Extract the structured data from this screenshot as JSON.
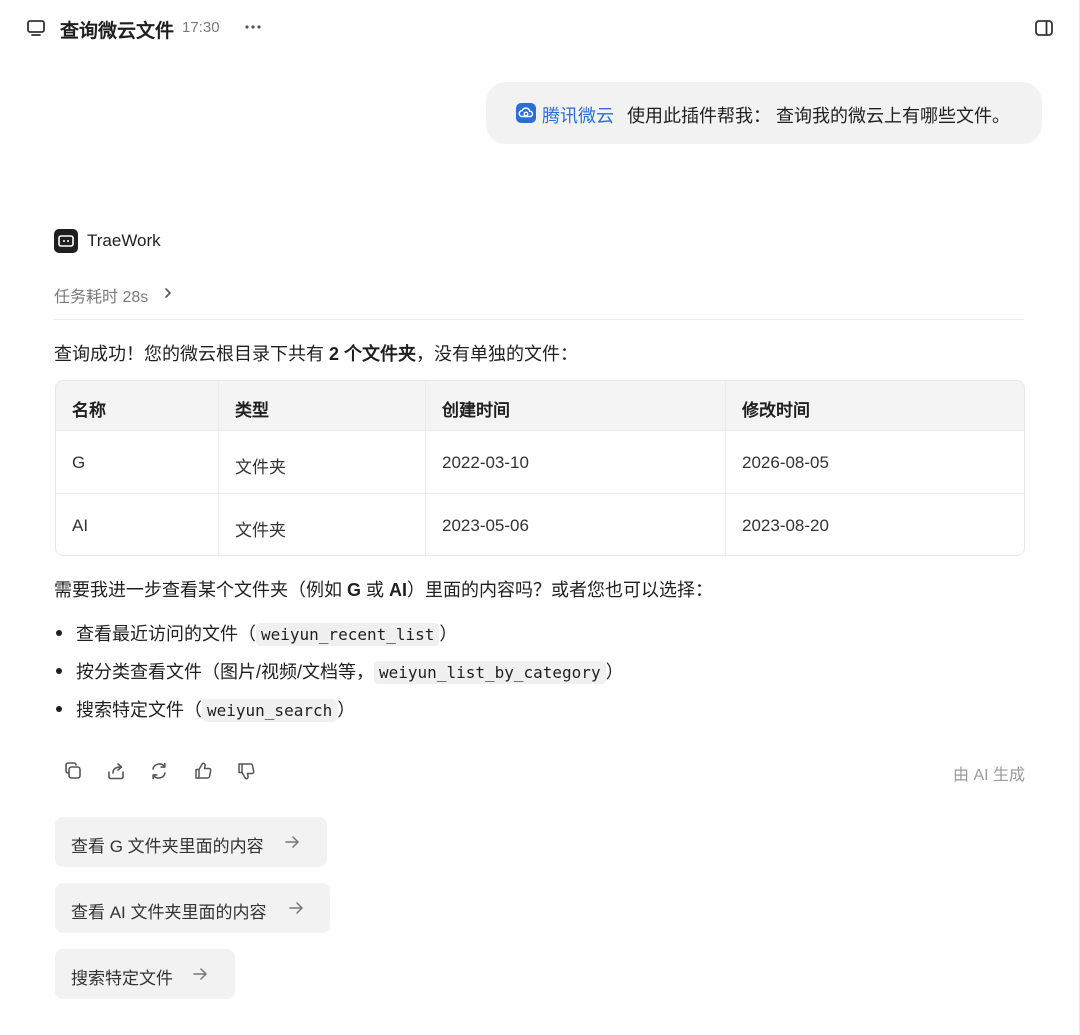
{
  "header": {
    "title": "查询微云文件",
    "time": "17:30",
    "more_label": "···"
  },
  "user_message": {
    "plugin_name": "腾讯微云",
    "text": "使用此插件帮我： 查询我的微云上有哪些文件。"
  },
  "assistant": {
    "name": "TraeWork",
    "duration": "任务耗时 28s",
    "intro_before": "查询成功！您的微云根目录下共有 ",
    "intro_bold": "2 个文件夹",
    "intro_after": "，没有单独的文件：",
    "table": {
      "headers": [
        "名称",
        "类型",
        "创建时间",
        "修改时间"
      ],
      "rows": [
        [
          "G",
          "文件夹",
          "2022-03-10",
          "2026-08-05"
        ],
        [
          "AI",
          "文件夹",
          "2023-05-06",
          "2023-08-20"
        ]
      ]
    },
    "question_before": "需要我进一步查看某个文件夹（例如 ",
    "question_g": "G",
    "question_or": " 或 ",
    "question_ai": "AI",
    "question_after": "）里面的内容吗？或者您也可以选择：",
    "bullets": [
      {
        "text": "查看最近访问的文件（",
        "code": "weiyun_recent_list",
        "end": "）"
      },
      {
        "text": "按分类查看文件（图片/视频/文档等，",
        "code": "weiyun_list_by_category",
        "end": "）"
      },
      {
        "text": "搜索特定文件（",
        "code": "weiyun_search",
        "end": "）"
      }
    ],
    "ai_generated": "由 AI 生成"
  },
  "suggestions": [
    {
      "label": "查看 G 文件夹里面的内容"
    },
    {
      "label": "查看 AI 文件夹里面的内容"
    },
    {
      "label": "搜索特定文件"
    }
  ],
  "colors": {
    "accent": "#2b6fd6",
    "bubble_bg": "#f2f2f3",
    "muted_text": "#7a7a7a"
  }
}
